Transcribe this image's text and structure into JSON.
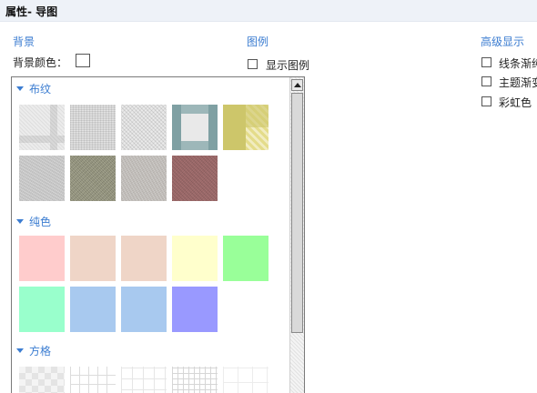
{
  "title": "属性- 导图",
  "background": {
    "heading": "背景",
    "color_label": "背景颜色：",
    "categories": [
      {
        "label": "布纹"
      },
      {
        "label": "纯色"
      },
      {
        "label": "方格"
      }
    ],
    "solid_colors": [
      "#ffcccc",
      "#efd5c7",
      "#efd5c7",
      "#ffffcc",
      "#99ff99",
      "#99ffcc",
      "#a8c9ef",
      "#a8c9ef",
      "#9999ff"
    ]
  },
  "legend": {
    "heading": "图例",
    "show_legend_label": "显示图例"
  },
  "advanced": {
    "heading": "高级显示",
    "options": [
      {
        "label": "线条渐纯"
      },
      {
        "label": "主题渐变"
      },
      {
        "label": "彩虹色"
      }
    ]
  }
}
